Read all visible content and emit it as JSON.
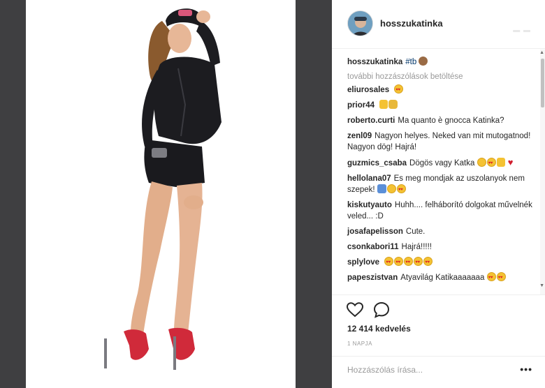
{
  "post": {
    "author": "hosszukatinka",
    "avatar_icon": "avatar-image",
    "photo_description_icon": "post-photo"
  },
  "caption": {
    "user": "hosszukatinka",
    "hashtag": "#tb"
  },
  "load_more_label": "további hozzászólások betöltése",
  "comments": [
    {
      "user": "eliurosales",
      "text": ""
    },
    {
      "user": "prior44",
      "text": ""
    },
    {
      "user": "roberto.curti",
      "text": "Ma quanto è gnocca Katinka?"
    },
    {
      "user": "zenl09",
      "text": "Nagyon helyes. Neked van mit mutogatnod! Nagyon dög! Hajrá!"
    },
    {
      "user": "guzmics_csaba",
      "text": "Dögös vagy Katka"
    },
    {
      "user": "hellolana07",
      "text": "Es meg mondjak az uszolanyok nem szepek!"
    },
    {
      "user": "kiskutyauto",
      "text": "Huhh.... felháborító dolgokat művelnék veled... :D"
    },
    {
      "user": "josafapelisson",
      "text": "Cute."
    },
    {
      "user": "csonkabori11",
      "text": "Hajrá!!!!!"
    },
    {
      "user": "splylove",
      "text": ""
    },
    {
      "user": "papeszistvan",
      "text": "Atyavilág Katikaaaaaaa"
    }
  ],
  "likes_label": "12 414 kedvelés",
  "time_label": "1 NAPJA",
  "add_comment": {
    "placeholder": "Hozzászólás írása..."
  },
  "more_label": "•••",
  "colors": {
    "background": "#3f3f41",
    "panel": "#ffffff",
    "link": "#003569",
    "muted": "#999999"
  }
}
